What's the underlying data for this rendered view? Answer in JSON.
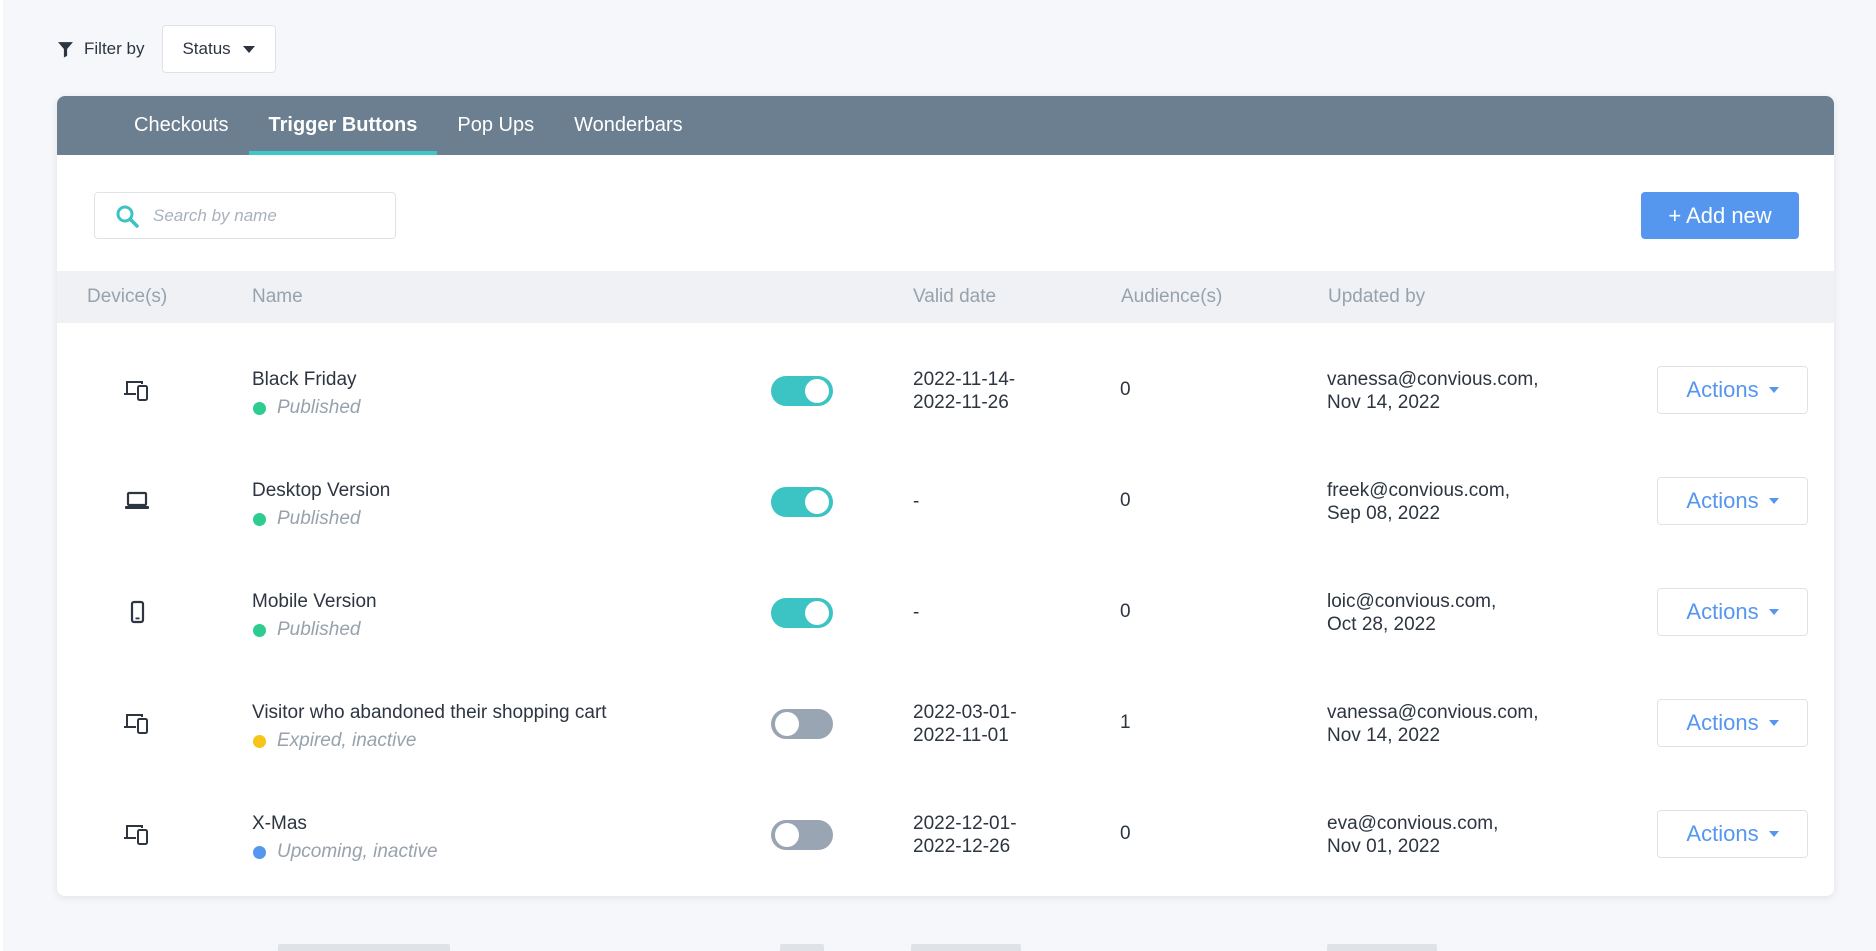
{
  "filter": {
    "label": "Filter by",
    "status_value": "Status"
  },
  "tabs": [
    {
      "label": "Checkouts",
      "active": false
    },
    {
      "label": "Trigger Buttons",
      "active": true
    },
    {
      "label": "Pop Ups",
      "active": false
    },
    {
      "label": "Wonderbars",
      "active": false
    }
  ],
  "search": {
    "placeholder": "Search by name",
    "value": ""
  },
  "add_button": {
    "label": "+ Add new"
  },
  "columns": {
    "devices": "Device(s)",
    "name": "Name",
    "valid_date": "Valid date",
    "audiences": "Audience(s)",
    "updated_by": "Updated by"
  },
  "rows": [
    {
      "device": "devices-icon",
      "name": "Black Friday",
      "status": "Published",
      "status_color": "#2ecc8f",
      "enabled": true,
      "valid_date_line1": "2022-11-14-",
      "valid_date_line2": "2022-11-26",
      "audience": "0",
      "updated_by_line1": "vanessa@convious.com,",
      "updated_by_line2": "Nov 14, 2022",
      "actions_label": "Actions"
    },
    {
      "device": "laptop-icon",
      "name": "Desktop Version",
      "status": "Published",
      "status_color": "#2ecc8f",
      "enabled": true,
      "valid_date_line1": "-",
      "valid_date_line2": "",
      "audience": "0",
      "updated_by_line1": "freek@convious.com,",
      "updated_by_line2": "Sep 08, 2022",
      "actions_label": "Actions"
    },
    {
      "device": "mobile-icon",
      "name": "Mobile Version",
      "status": "Published",
      "status_color": "#2ecc8f",
      "enabled": true,
      "valid_date_line1": "-",
      "valid_date_line2": "",
      "audience": "0",
      "updated_by_line1": "loic@convious.com,",
      "updated_by_line2": "Oct 28, 2022",
      "actions_label": "Actions"
    },
    {
      "device": "devices-icon",
      "name": "Visitor who abandoned their shopping cart",
      "status": "Expired, inactive",
      "status_color": "#f5c518",
      "enabled": false,
      "valid_date_line1": "2022-03-01-",
      "valid_date_line2": "2022-11-01",
      "audience": "1",
      "updated_by_line1": "vanessa@convious.com,",
      "updated_by_line2": "Nov 14, 2022",
      "actions_label": "Actions"
    },
    {
      "device": "devices-icon",
      "name": "X-Mas",
      "status": "Upcoming, inactive",
      "status_color": "#5596ef",
      "enabled": false,
      "valid_date_line1": "2022-12-01-",
      "valid_date_line2": "2022-12-26",
      "audience": "0",
      "updated_by_line1": "eva@convious.com,",
      "updated_by_line2": "Nov 01, 2022",
      "actions_label": "Actions"
    }
  ],
  "colors": {
    "tab_bar": "#6b7f91",
    "tab_indicator": "#3cc8c8",
    "primary": "#5596ef",
    "toggle_on": "#3cc3c3",
    "toggle_off": "#9aa5b3"
  }
}
